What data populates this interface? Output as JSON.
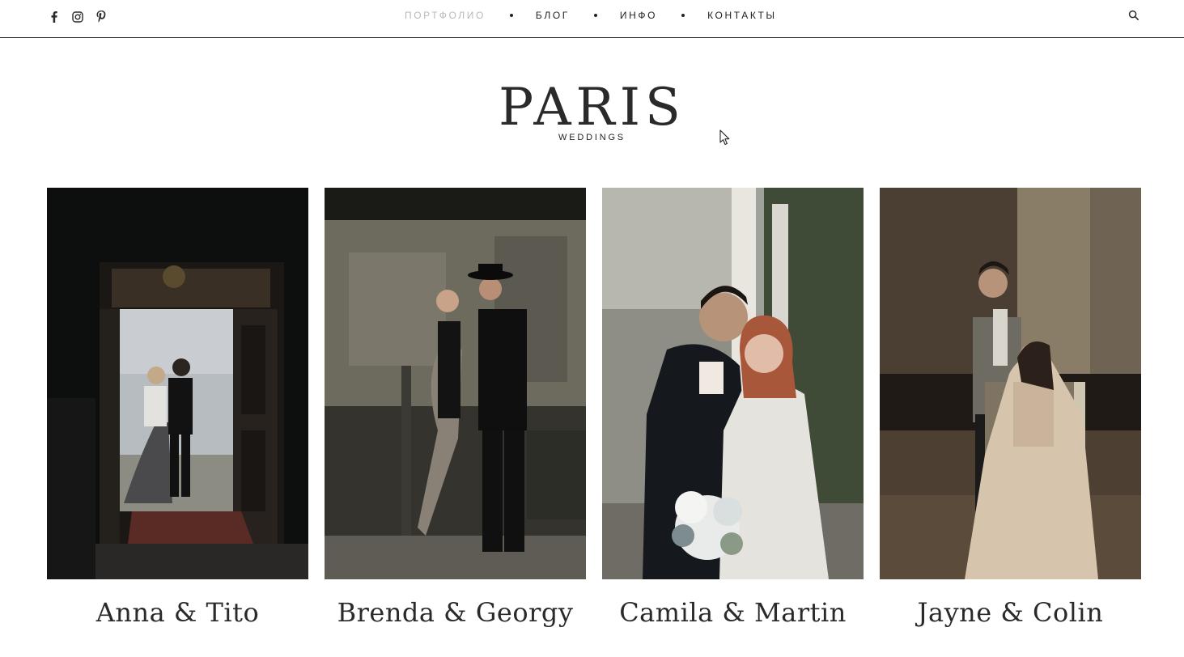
{
  "social": {
    "facebook": "facebook-icon",
    "instagram": "instagram-icon",
    "pinterest": "pinterest-icon"
  },
  "nav": {
    "items": [
      {
        "label": "ПОРТФОЛИО",
        "active": true
      },
      {
        "label": "БЛОГ",
        "active": false
      },
      {
        "label": "ИНФО",
        "active": false
      },
      {
        "label": "КОНТАКТЫ",
        "active": false
      }
    ],
    "search_icon": "search-icon"
  },
  "brand": {
    "title": "PARIS"
  },
  "category": {
    "label": "WEDDINGS"
  },
  "gallery": {
    "items": [
      {
        "title": "Anna & Tito"
      },
      {
        "title": "Brenda & Georgy"
      },
      {
        "title": "Camila & Martin"
      },
      {
        "title": "Jayne & Colin"
      }
    ]
  },
  "colors": {
    "text": "#2a2a2a",
    "nav_active": "#b8b8b8",
    "background": "#ffffff"
  }
}
